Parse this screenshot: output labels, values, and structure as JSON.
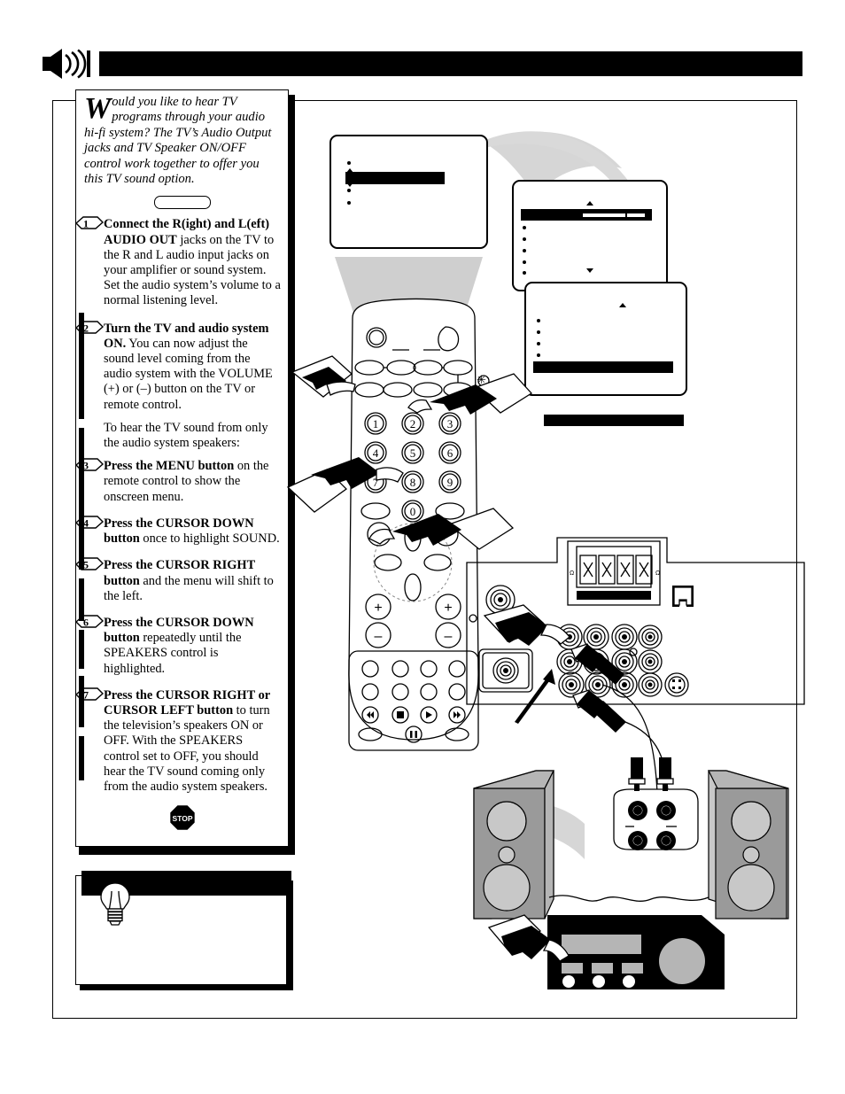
{
  "header": {
    "icon": "speaker-sound-icon",
    "title": ""
  },
  "intro": {
    "dropcap": "W",
    "text": "ould you like to hear TV programs through your audio hi-fi system?  The TV’s Audio Output jacks and TV Speaker ON/OFF control work together to offer you this TV sound option."
  },
  "steps": [
    {
      "number": "1",
      "bold": "Connect the R(ight) and L(eft) AUDIO OUT",
      "rest": " jacks on the TV to the R and L audio input jacks on your amplifier or sound system.  Set the audio system’s volume to a normal listening level."
    },
    {
      "number": "2",
      "bold": "Turn the TV and audio system ON.",
      "rest": "  You can now adjust the sound level coming from the audio system with the VOLUME (+) or (–) button on the TV or remote control."
    },
    {
      "number": "3",
      "bold": "Press the MENU button",
      "rest": " on the remote control to show the onscreen menu."
    },
    {
      "number": "4",
      "bold": "Press the CURSOR DOWN button",
      "rest": " once to highlight SOUND."
    },
    {
      "number": "5",
      "bold": "Press the CURSOR RIGHT button",
      "rest": " and the menu will shift to the left."
    },
    {
      "number": "6",
      "bold": "Press the CURSOR DOWN button",
      "rest": " repeatedly until the SPEAKERS control is highlighted."
    },
    {
      "number": "7",
      "bold": "Press the CURSOR RIGHT or CURSOR LEFT button",
      "rest": " to turn the television’s speakers ON or OFF. With the SPEAKERS control set to OFF, you should hear the TV sound coming only from the audio system speakers."
    }
  ],
  "mid_note": "To hear the TV sound from only the audio system speakers:",
  "stop_badge": "STOP",
  "tip": {
    "icon": "lightbulb-icon",
    "header": "",
    "body": ""
  },
  "osd": {
    "screen1": {
      "items": [
        "",
        "",
        "",
        ""
      ],
      "highlighted_index": 1,
      "label": ""
    },
    "screen2": {
      "items": [
        "",
        "",
        "",
        "",
        "",
        ""
      ],
      "highlighted_index": 0,
      "label": "",
      "has_slider": true
    },
    "screen3": {
      "items": [
        "",
        "",
        "",
        "",
        ""
      ],
      "highlighted_index": 4,
      "label": ""
    },
    "standalone_bar": {
      "label": ""
    }
  },
  "remote": {
    "keys_numeric": [
      "1",
      "2",
      "3",
      "4",
      "5",
      "6",
      "7",
      "8",
      "9",
      "0"
    ],
    "volume_up": "+",
    "volume_down": "–",
    "channel_up": "+",
    "transport": [
      "◀◀",
      "■",
      "▶",
      "▶▶",
      "❙❙"
    ]
  },
  "colors": {
    "ink": "#000000",
    "paper": "#ffffff",
    "beam": "#d0d0d0",
    "speaker_body": "#9a9a9a",
    "speaker_cone": "#c8c8c8"
  }
}
